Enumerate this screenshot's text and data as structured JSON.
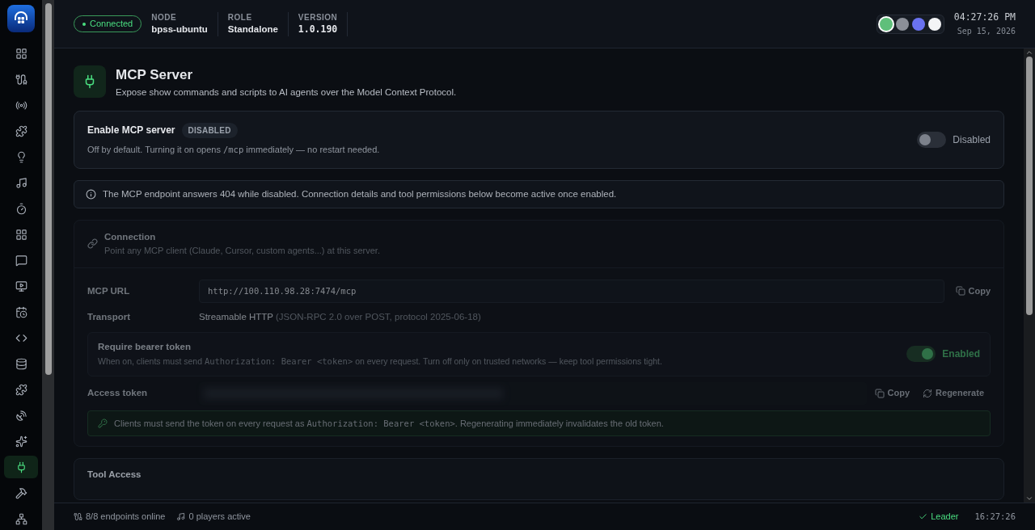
{
  "header": {
    "status": "Connected",
    "info": [
      {
        "label": "NODE",
        "value": "bpss-ubuntu",
        "kind": "text"
      },
      {
        "label": "ROLE",
        "value": "Standalone",
        "kind": "text"
      },
      {
        "label": "VERSION",
        "value": "1.0.190",
        "kind": "mono"
      }
    ],
    "themes": [
      {
        "color": "#5fbf7a",
        "selected": true
      },
      {
        "color": "#8b8f98",
        "selected": false
      },
      {
        "color": "#6a72f0",
        "selected": false
      },
      {
        "color": "#f3f4f6",
        "selected": false
      }
    ],
    "time": "04:27:26 PM",
    "date": "Sep 15, 2026"
  },
  "sidebar": {
    "items": [
      {
        "selected": false
      },
      {
        "selected": false
      },
      {
        "selected": false
      },
      {
        "selected": false
      },
      {
        "selected": false
      },
      {
        "selected": false
      },
      {
        "selected": false
      },
      {
        "selected": false
      },
      {
        "selected": false
      },
      {
        "selected": false
      },
      {
        "selected": false
      },
      {
        "selected": false
      },
      {
        "selected": false
      },
      {
        "selected": false
      },
      {
        "selected": false
      },
      {
        "selected": false
      },
      {
        "selected": true
      },
      {
        "selected": false
      },
      {
        "selected": false
      }
    ]
  },
  "page": {
    "title": "MCP Server",
    "subtitle": "Expose show commands and scripts to AI agents over the Model Context Protocol."
  },
  "enable": {
    "title": "Enable MCP server",
    "badge": "DISABLED",
    "description": [
      {
        "kind": "text",
        "text": "Off by default. Turning it on opens "
      },
      {
        "kind": "code",
        "text": "/mcp"
      },
      {
        "kind": "text",
        "text": " immediately — no restart needed."
      }
    ],
    "on": false,
    "state_label": "Disabled"
  },
  "notice": "The MCP endpoint answers 404 while disabled. Connection details and tool permissions below become active once enabled.",
  "connection": {
    "title": "Connection",
    "subtitle": "Point any MCP client (Claude, Cursor, custom agents...) at this server.",
    "url_label": "MCP URL",
    "url": "http://100.110.98.28:7474/mcp",
    "copy": "Copy",
    "transport_label": "Transport",
    "transport": "Streamable HTTP",
    "transport_detail": "(JSON-RPC 2.0 over POST, protocol 2025-06-18)",
    "bearer": {
      "title": "Require bearer token",
      "description": [
        {
          "kind": "text",
          "text": "When on, clients must send "
        },
        {
          "kind": "code",
          "text": "Authorization: Bearer <token>"
        },
        {
          "kind": "text",
          "text": " on every request. Turn off only on trusted networks — keep tool permissions tight."
        }
      ],
      "on": true,
      "state_label": "Enabled"
    },
    "token_label": "Access token",
    "token_copy": "Copy",
    "regenerate": "Regenerate",
    "hint": [
      {
        "kind": "text",
        "text": "Clients must send the token on every request as "
      },
      {
        "kind": "code",
        "text": "Authorization: Bearer <token>"
      },
      {
        "kind": "text",
        "text": ". Regenerating immediately invalidates the old token."
      }
    ]
  },
  "next_section": {
    "title": "Tool Access"
  },
  "status_bar": {
    "endpoints": "8/8 endpoints online",
    "players": "0 players active",
    "leader": "Leader",
    "time": "16:27:26"
  }
}
